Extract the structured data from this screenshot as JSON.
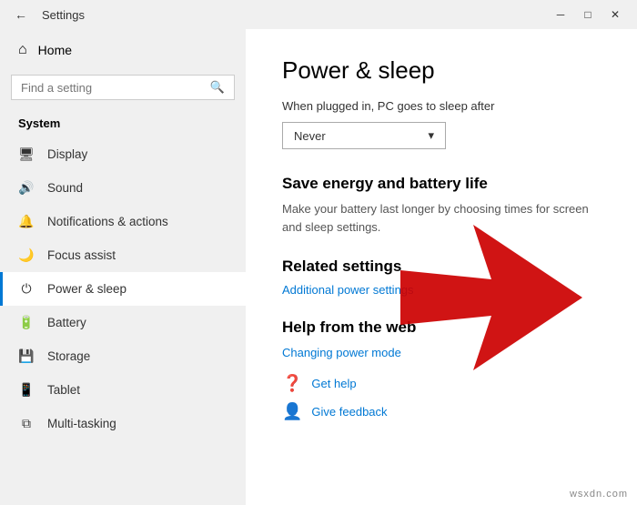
{
  "titleBar": {
    "title": "Settings",
    "backLabel": "←",
    "minimizeLabel": "─",
    "maximizeLabel": "□",
    "closeLabel": "✕"
  },
  "sidebar": {
    "homeLabel": "Home",
    "searchPlaceholder": "Find a setting",
    "sectionLabel": "System",
    "items": [
      {
        "id": "display",
        "label": "Display",
        "icon": "🖥"
      },
      {
        "id": "sound",
        "label": "Sound",
        "icon": "🔊"
      },
      {
        "id": "notifications",
        "label": "Notifications & actions",
        "icon": "🔔"
      },
      {
        "id": "focus",
        "label": "Focus assist",
        "icon": "🌙"
      },
      {
        "id": "power",
        "label": "Power & sleep",
        "icon": "⏻",
        "active": true
      },
      {
        "id": "battery",
        "label": "Battery",
        "icon": "🔋"
      },
      {
        "id": "storage",
        "label": "Storage",
        "icon": "💾"
      },
      {
        "id": "tablet",
        "label": "Tablet",
        "icon": "📱"
      },
      {
        "id": "multitasking",
        "label": "Multi-tasking",
        "icon": "⧉"
      }
    ]
  },
  "content": {
    "title": "Power & sleep",
    "pluggedInLabel": "When plugged in, PC goes to sleep after",
    "dropdownValue": "Never",
    "dropdownArrow": "▾",
    "saveEnergyHeading": "Save energy and battery life",
    "saveEnergyDesc": "Make your battery last longer by choosing times for screen and sleep settings.",
    "relatedHeading": "Related settings",
    "relatedLinks": [
      {
        "id": "additional-power",
        "label": "Additional power settings"
      }
    ],
    "helpHeading": "Help from the web",
    "helpLinks": [
      {
        "id": "changing-power",
        "label": "Changing power mode"
      }
    ],
    "helpItems": [
      {
        "id": "get-help",
        "label": "Get help",
        "icon": "❓"
      },
      {
        "id": "give-feedback",
        "label": "Give feedback",
        "icon": "👤"
      }
    ]
  },
  "watermark": "wsxdn.com"
}
